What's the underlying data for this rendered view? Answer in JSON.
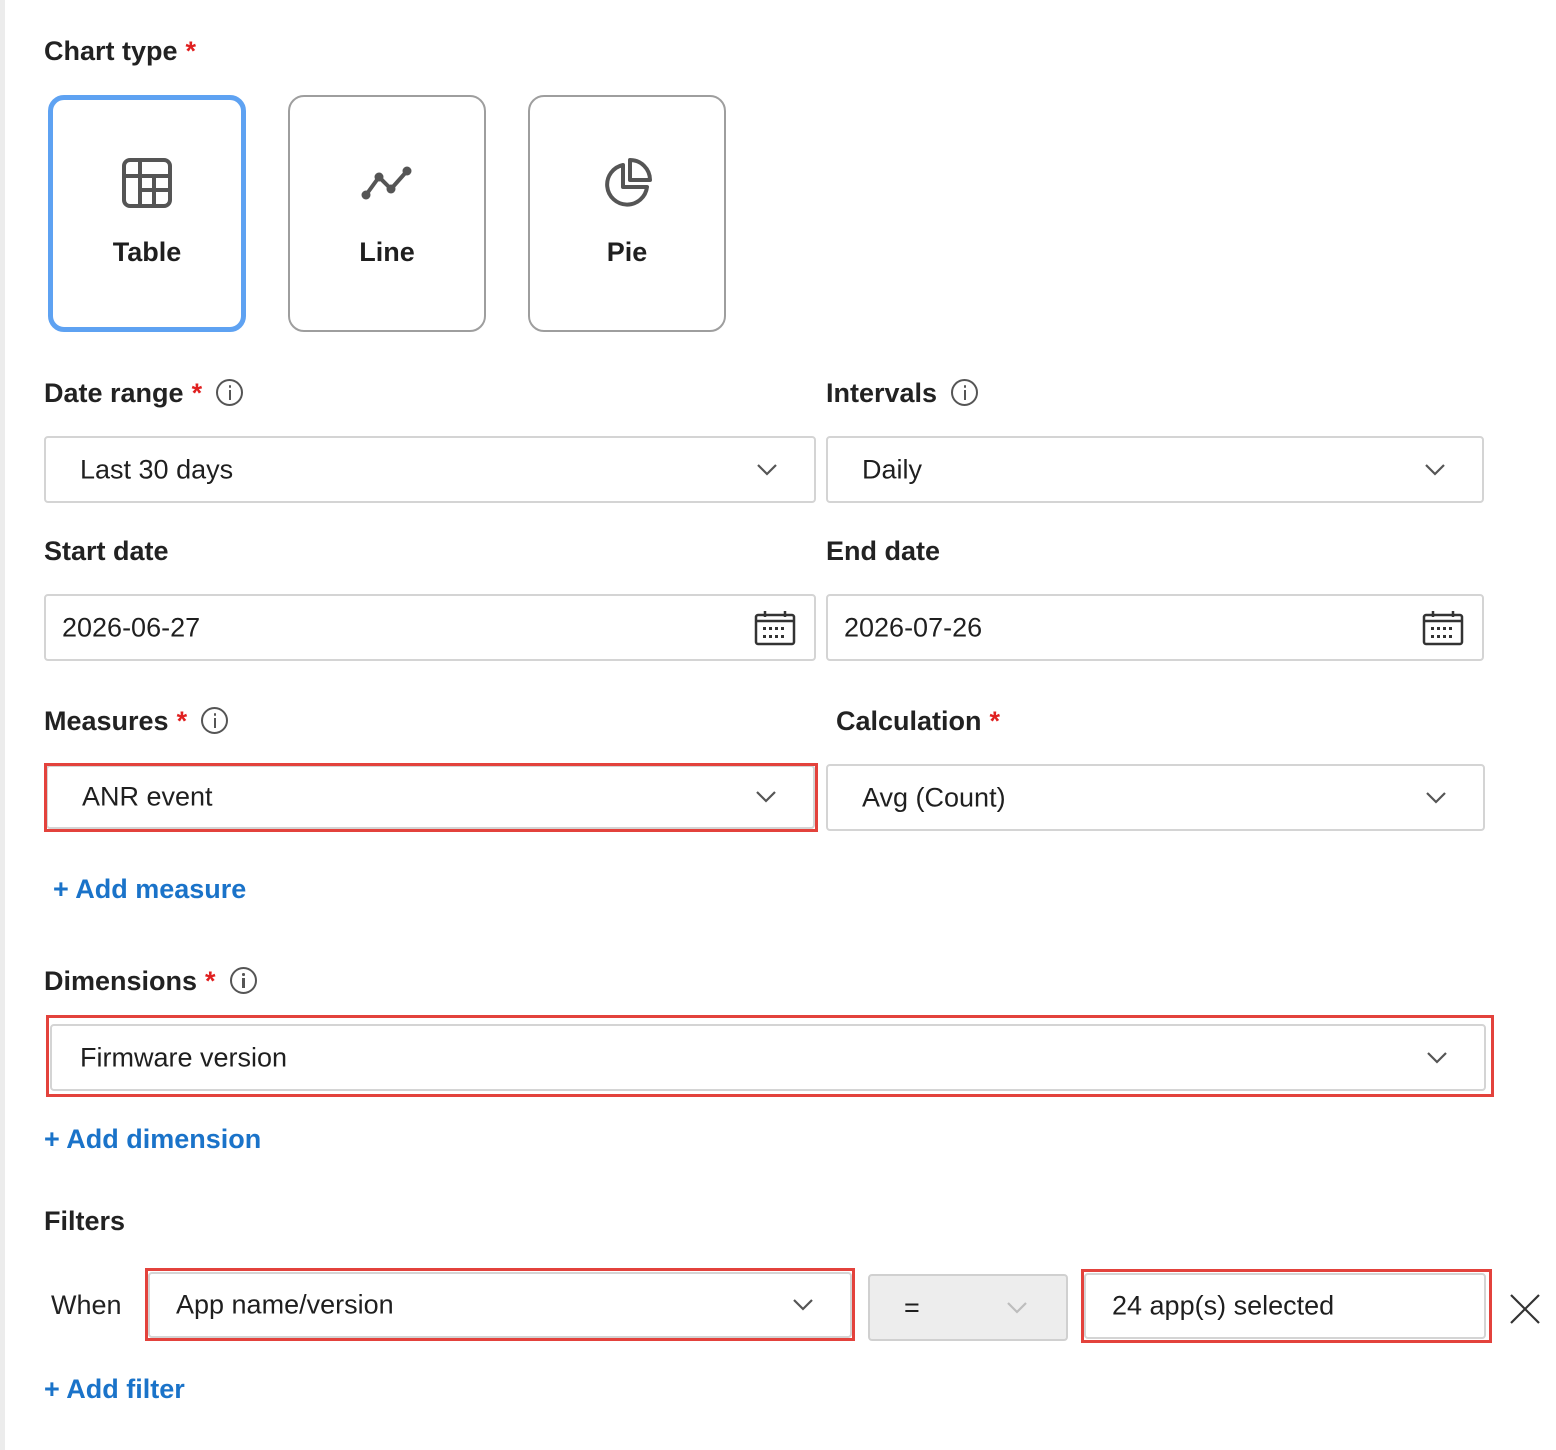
{
  "chart_type": {
    "label": "Chart type",
    "required_mark": "*",
    "options": [
      {
        "label": "Table",
        "icon": "table-icon",
        "selected": true
      },
      {
        "label": "Line",
        "icon": "line-chart-icon",
        "selected": false
      },
      {
        "label": "Pie",
        "icon": "pie-chart-icon",
        "selected": false
      }
    ]
  },
  "date_range": {
    "label": "Date range",
    "required_mark": "*",
    "value": "Last 30 days"
  },
  "intervals": {
    "label": "Intervals",
    "value": "Daily"
  },
  "start_date": {
    "label": "Start date",
    "value": "2026-06-27"
  },
  "end_date": {
    "label": "End date",
    "value": "2026-07-26"
  },
  "measures": {
    "label": "Measures",
    "required_mark": "*",
    "value": "ANR event",
    "add_label": "+ Add measure"
  },
  "calculation": {
    "label": "Calculation",
    "required_mark": "*",
    "value": "Avg (Count)"
  },
  "dimensions": {
    "label": "Dimensions",
    "required_mark": "*",
    "value": "Firmware version",
    "add_label": "+ Add dimension"
  },
  "filters": {
    "label": "Filters",
    "when_label": "When",
    "field_value": "App name/version",
    "operator_value": "=",
    "selection_value": "24 app(s) selected",
    "add_label": "+ Add filter"
  },
  "colors": {
    "accent": "#1a73c9",
    "selected_border": "#5ea2f2",
    "required": "#e02020",
    "highlight": "#e3423c"
  }
}
